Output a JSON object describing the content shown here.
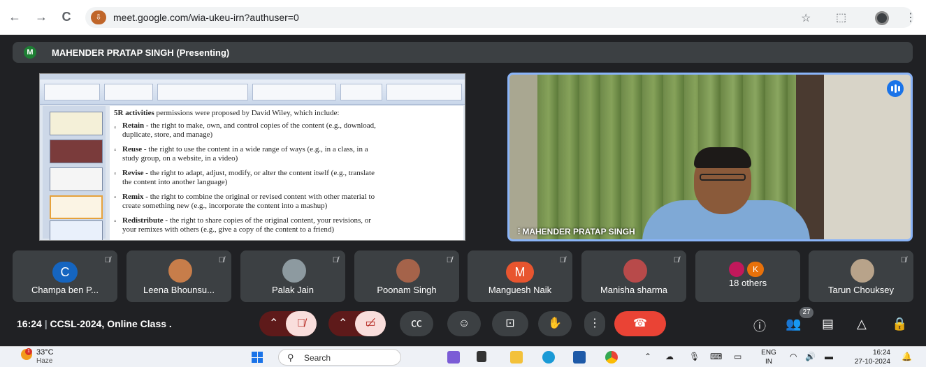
{
  "browser": {
    "url": "meet.google.com/wia-ukeu-irn?authuser=0",
    "back_icon": "←",
    "forward_icon": "→",
    "reload_icon": "C",
    "star_icon": "☆",
    "menu_icon": "⋮"
  },
  "meet": {
    "presenter_initial": "M",
    "presenter_label": "MAHENDER PRATAP SINGH (Presenting)",
    "camera_name": "MAHENDER PRATAP SINGH",
    "slide": {
      "lines": [
        {
          "bold": "5R activities",
          "text": " permissions were proposed by David Wiley, which include:"
        },
        {
          "bold": "Retain -",
          "text": " the right to make, own, and control copies of the content (e.g., download,"
        },
        {
          "bold": "",
          "text": "duplicate, store, and manage)"
        },
        {
          "bold": "Reuse -",
          "text": " the right to use the content in a wide range of ways (e.g., in a class, in a"
        },
        {
          "bold": "",
          "text": "study group, on a website, in a video)"
        },
        {
          "bold": "Revise -",
          "text": " the right to adapt, adjust, modify, or alter the content itself (e.g., translate"
        },
        {
          "bold": "",
          "text": "the content into another language)"
        },
        {
          "bold": "Remix -",
          "text": " the right to combine the original or revised content with other material to"
        },
        {
          "bold": "",
          "text": "create something new (e.g., incorporate the content into a mashup)"
        },
        {
          "bold": "Redistribute -",
          "text": " the right to share copies of the original content, your revisions, or"
        },
        {
          "bold": "",
          "text": "your remixes with others (e.g., give a copy of the content to a friend)"
        }
      ]
    },
    "participants": [
      {
        "name": "Champa ben P...",
        "initial": "C",
        "color": "#1565c0"
      },
      {
        "name": "Leena Bhounsu...",
        "initial": "",
        "color": "#c77d4a"
      },
      {
        "name": "Palak Jain",
        "initial": "",
        "color": "#8d9aa0"
      },
      {
        "name": "Poonam Singh",
        "initial": "",
        "color": "#a5634a"
      },
      {
        "name": "Manguesh Naik",
        "initial": "M",
        "color": "#e8552f"
      },
      {
        "name": "Manisha sharma",
        "initial": "",
        "color": "#b84a4a"
      },
      {
        "name": "18 others",
        "initial": "K",
        "color": "#e8710a"
      },
      {
        "name": "Tarun Chouksey",
        "initial": "",
        "color": "#b8a38a"
      }
    ],
    "meeting_time": "16:24",
    "meeting_title": "CCSL-2024, Online Class .",
    "people_count": "27"
  },
  "taskbar": {
    "temp": "33°C",
    "weather": "Haze",
    "weather_badge": "1",
    "search_label": "Search",
    "lang_1": "ENG",
    "lang_2": "IN",
    "time": "16:24",
    "date": "27-10-2024"
  }
}
